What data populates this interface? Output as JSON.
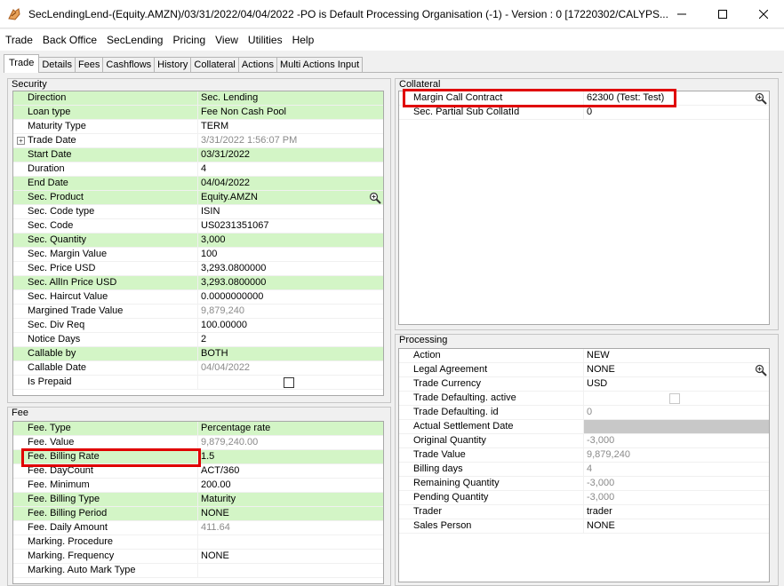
{
  "window": {
    "title": "SecLendingLend-(Equity.AMZN)/03/31/2022/04/04/2022  -PO is Default Processing Organisation  (-1) - Version : 0  [17220302/CALYPS..."
  },
  "menu": [
    "Trade",
    "Back Office",
    "SecLending",
    "Pricing",
    "View",
    "Utilities",
    "Help"
  ],
  "tabs": [
    "Trade",
    "Details",
    "Fees",
    "Cashflows",
    "History",
    "Collateral",
    "Actions",
    "Multi Actions Input"
  ],
  "security": {
    "title": "Security",
    "rows": [
      {
        "label": "Direction",
        "value": "Sec. Lending"
      },
      {
        "label": "Loan type",
        "value": "Fee Non Cash Pool"
      },
      {
        "label": "Maturity Type",
        "value": "TERM"
      },
      {
        "label": "Trade Date",
        "value": "3/31/2022 1:56:07 PM"
      },
      {
        "label": "Start Date",
        "value": "03/31/2022"
      },
      {
        "label": "Duration",
        "value": "4"
      },
      {
        "label": "End Date",
        "value": "04/04/2022"
      },
      {
        "label": "Sec. Product",
        "value": "Equity.AMZN"
      },
      {
        "label": "Sec. Code type",
        "value": "ISIN"
      },
      {
        "label": "Sec. Code",
        "value": "US0231351067"
      },
      {
        "label": "Sec. Quantity",
        "value": "3,000"
      },
      {
        "label": "Sec. Margin Value",
        "value": "100"
      },
      {
        "label": "Sec. Price USD",
        "value": "3,293.0800000"
      },
      {
        "label": "Sec. AllIn Price USD",
        "value": "3,293.0800000"
      },
      {
        "label": "Sec. Haircut Value",
        "value": "0.0000000000"
      },
      {
        "label": "Margined Trade Value",
        "value": "9,879,240"
      },
      {
        "label": "Sec. Div Req",
        "value": "100.00000"
      },
      {
        "label": "Notice Days",
        "value": "2"
      },
      {
        "label": "Callable by",
        "value": "BOTH"
      },
      {
        "label": "Callable Date",
        "value": "04/04/2022"
      },
      {
        "label": "Is Prepaid",
        "value": ""
      }
    ]
  },
  "fee": {
    "title": "Fee",
    "rows": [
      {
        "label": "Fee. Type",
        "value": "Percentage rate"
      },
      {
        "label": "Fee. Value",
        "value": "9,879,240.00"
      },
      {
        "label": "Fee. Billing Rate",
        "value": "1.5"
      },
      {
        "label": "Fee. DayCount",
        "value": "ACT/360"
      },
      {
        "label": "Fee. Minimum",
        "value": "200.00"
      },
      {
        "label": "Fee. Billing Type",
        "value": "Maturity"
      },
      {
        "label": "Fee. Billing Period",
        "value": "NONE"
      },
      {
        "label": "Fee. Daily Amount",
        "value": "411.64"
      },
      {
        "label": "Marking. Procedure",
        "value": ""
      },
      {
        "label": "Marking. Frequency",
        "value": "NONE"
      },
      {
        "label": "Marking. Auto Mark Type",
        "value": ""
      }
    ]
  },
  "collateral": {
    "title": "Collateral",
    "rows": [
      {
        "label": "Margin Call Contract",
        "value": "62300 (Test: Test)"
      },
      {
        "label": "Sec. Partial Sub CollatId",
        "value": "0"
      }
    ]
  },
  "processing": {
    "title": "Processing",
    "rows": [
      {
        "label": "Action",
        "value": "NEW"
      },
      {
        "label": "Legal Agreement",
        "value": "NONE"
      },
      {
        "label": "Trade Currency",
        "value": "USD"
      },
      {
        "label": "Trade Defaulting. active",
        "value": ""
      },
      {
        "label": "Trade Defaulting. id",
        "value": "0"
      },
      {
        "label": "Actual Settlement Date",
        "value": ""
      },
      {
        "label": "Original Quantity",
        "value": "-3,000"
      },
      {
        "label": "Trade Value",
        "value": "9,879,240"
      },
      {
        "label": "Billing days",
        "value": "4"
      },
      {
        "label": "Remaining Quantity",
        "value": "-3,000"
      },
      {
        "label": "Pending Quantity",
        "value": "-3,000"
      },
      {
        "label": "Trader",
        "value": "trader"
      },
      {
        "label": "Sales Person",
        "value": "NONE"
      }
    ]
  },
  "colors": {
    "green_row": "#d3f5c6",
    "highlight": "#e00000"
  }
}
